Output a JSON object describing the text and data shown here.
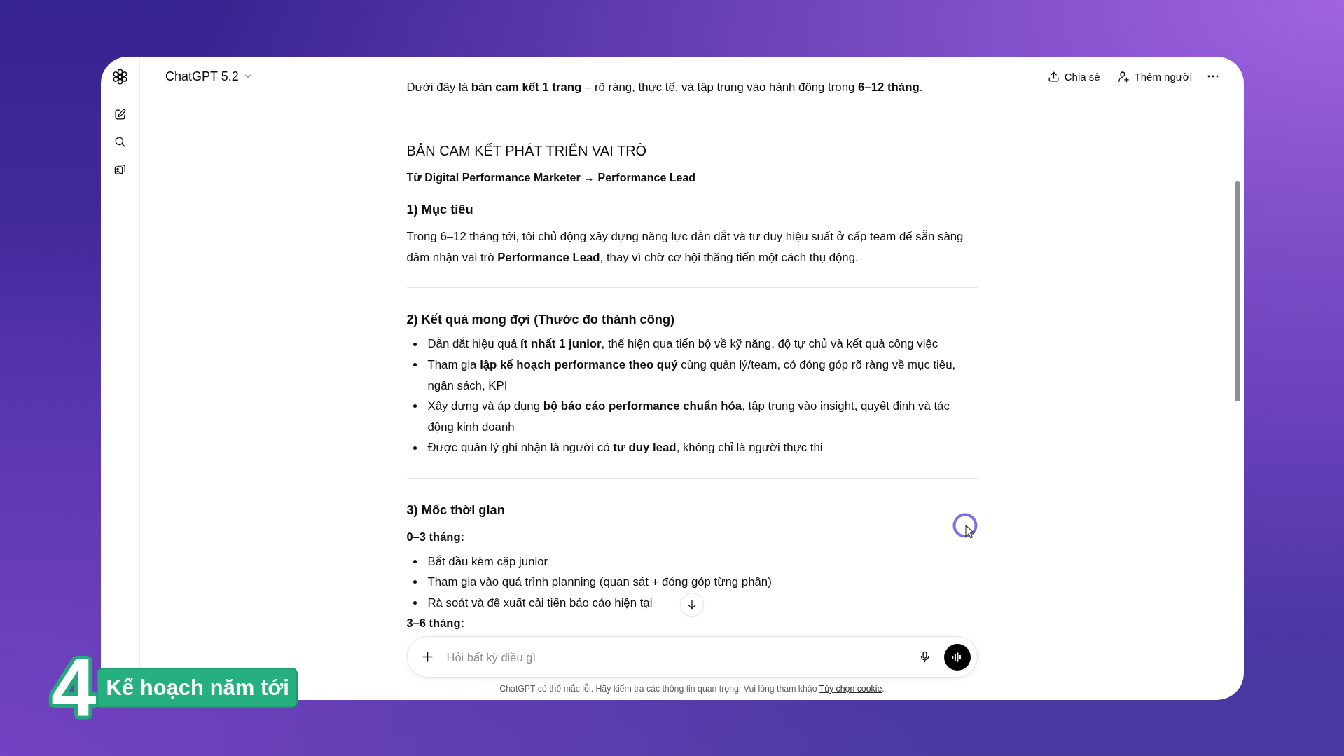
{
  "header": {
    "model_selector": "ChatGPT 5.2",
    "actions": [
      {
        "label": "Chia sẻ"
      },
      {
        "label": "Thêm người"
      }
    ]
  },
  "message": {
    "blocks": [
      {
        "kind": "paragraph",
        "text": "Dưới đây là **bản cam kết 1 trang** – rõ ràng, thực tế, và tập trung vào hành động trong **6–12 tháng**."
      },
      {
        "kind": "rule"
      },
      {
        "kind": "title",
        "text": "BẢN CAM KẾT PHÁT TRIỂN VAI TRÒ"
      },
      {
        "kind": "subtitle",
        "text": "Từ Digital Performance Marketer → Performance Lead"
      },
      {
        "kind": "section",
        "text": "1) Mục tiêu"
      },
      {
        "kind": "paragraph",
        "text": "Trong 6–12 tháng tới, tôi chủ động xây dựng năng lực dẫn dắt và tư duy hiệu suất ở cấp team để sẵn sàng đảm nhận vai trò **Performance Lead**, thay vì chờ cơ hội thăng tiến một cách thụ động."
      },
      {
        "kind": "rule"
      },
      {
        "kind": "section",
        "text": "2) Kết quả mong đợi (Thước đo thành công)"
      },
      {
        "kind": "list",
        "items": [
          "Dẫn dắt hiệu quả **ít nhất 1 junior**, thể hiện qua tiến bộ về kỹ năng, độ tự chủ và kết quả công việc",
          "Tham gia **lập kế hoạch performance theo quý** cùng quản lý/team, có đóng góp rõ ràng về mục tiêu, ngân sách, KPI",
          "Xây dựng và áp dụng **bộ báo cáo performance chuẩn hóa**, tập trung vào insight, quyết định và tác động kinh doanh",
          "Được quản lý ghi nhận là người có **tư duy lead**, không chỉ là người thực thi"
        ]
      },
      {
        "kind": "rule"
      },
      {
        "kind": "section",
        "text": "3) Mốc thời gian"
      },
      {
        "kind": "label",
        "text": "0–3 tháng:"
      },
      {
        "kind": "list",
        "items": [
          "Bắt đầu kèm cặp junior",
          "Tham gia vào quá trình planning (quan sát + đóng góp từng phần)",
          "Rà soát và đề xuất cải tiến báo cáo hiện tại"
        ]
      },
      {
        "kind": "label",
        "text": "3–6 tháng:"
      }
    ]
  },
  "composer": {
    "placeholder": "Hỏi bất kỳ điều gì"
  },
  "footer": {
    "text": "ChatGPT có thể mắc lỗi. Hãy kiểm tra các thông tin quan trọng. Vui lòng tham khảo ",
    "link": "Tùy chọn cookie",
    "end": "."
  },
  "chapter_caption": {
    "number": "4",
    "title": "Kế hoạch năm tới"
  }
}
